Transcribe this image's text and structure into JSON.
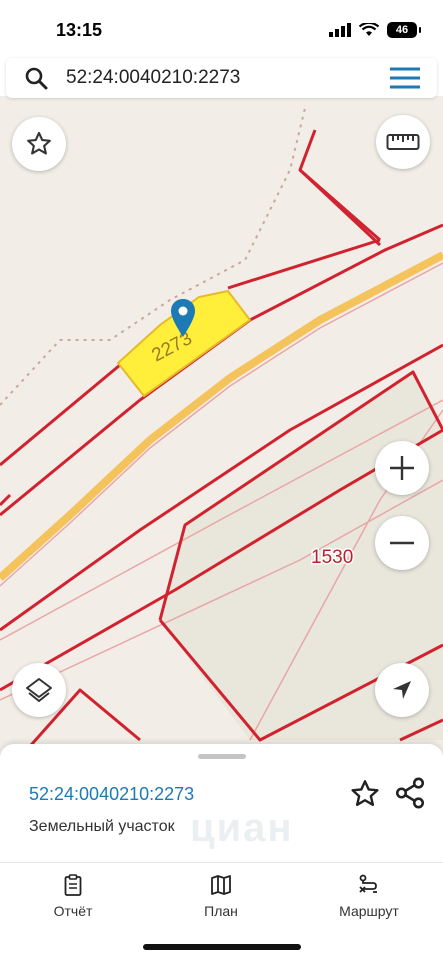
{
  "status": {
    "time": "13:15",
    "battery": "46"
  },
  "search": {
    "query": "52:24:0040210:2273"
  },
  "map": {
    "parcel_label": "2273",
    "neighbor_label": "1530",
    "colors": {
      "boundary": "#d1222f",
      "highlight": "#ffef3a",
      "road": "#f7c64f",
      "background": "#f2eee7",
      "pin": "#1d7ab4"
    }
  },
  "sheet": {
    "title": "52:24:0040210:2273",
    "subtitle": "Земельный участок",
    "watermark": "циан"
  },
  "tabs": [
    {
      "label": "Отчёт",
      "icon": "clipboard-icon"
    },
    {
      "label": "План",
      "icon": "map-icon"
    },
    {
      "label": "Маршрут",
      "icon": "route-icon"
    }
  ]
}
